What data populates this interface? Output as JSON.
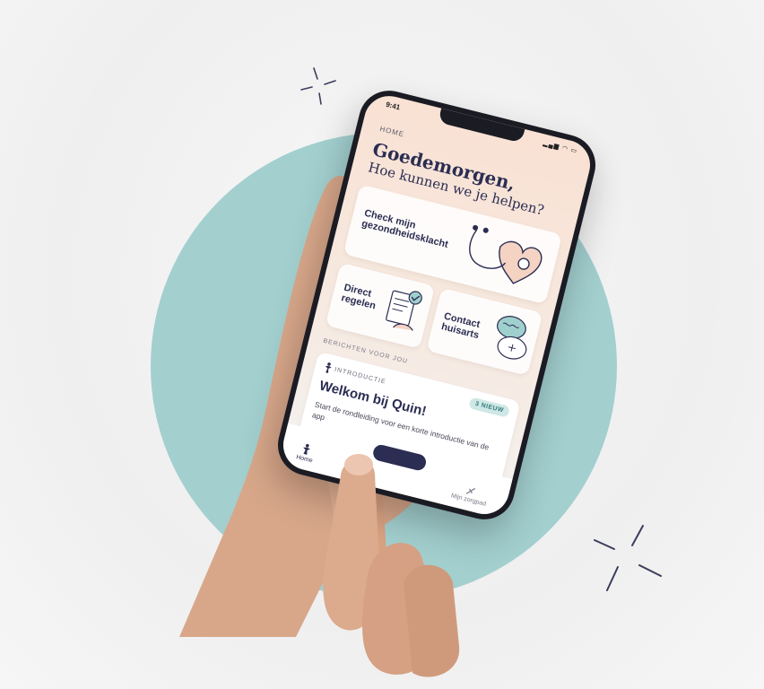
{
  "status": {
    "time": "9:41"
  },
  "header": {
    "breadcrumb": "HOME",
    "greeting": "Goedemorgen,",
    "question": "Hoe kunnen we je helpen?"
  },
  "cards": [
    {
      "label": "Check mijn gezondheidsklacht"
    },
    {
      "label": "Direct regelen"
    },
    {
      "label": "Contact huisarts"
    }
  ],
  "messages": {
    "section_title": "BERICHTEN VOOR JOU",
    "item": {
      "tag": "INTRODUCTIE",
      "badge": "3 NIEUW",
      "title": "Welkom bij Quin!",
      "body": "Start de rondleiding voor een korte introductie van de app"
    }
  },
  "tabbar": {
    "home": "Home",
    "mijn": "Mijn zorgpad"
  },
  "colors": {
    "accent": "#2b2d52",
    "circle": "#a3cfcf",
    "screen_top": "#f9e1d3",
    "badge": "#cfe8e6"
  }
}
